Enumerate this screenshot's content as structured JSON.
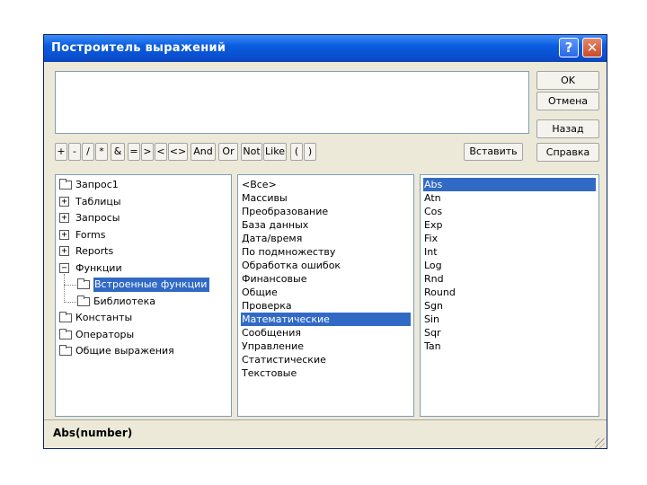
{
  "window": {
    "title": "Построитель выражений",
    "help_glyph": "?",
    "close_glyph": "✕"
  },
  "expression": {
    "value": ""
  },
  "right_buttons": {
    "ok": "OK",
    "cancel": "Отмена",
    "back": "Назад",
    "help": "Справка"
  },
  "operators": [
    "+",
    "-",
    "/",
    "*",
    "&",
    "=",
    ">",
    "<",
    "<>",
    "And",
    "Or",
    "Not",
    "Like",
    "(",
    ")"
  ],
  "insert_label": "Вставить",
  "tree": [
    {
      "label": "Запрос1",
      "expander": "",
      "level": 0
    },
    {
      "label": "Таблицы",
      "expander": "+",
      "level": 0
    },
    {
      "label": "Запросы",
      "expander": "+",
      "level": 0
    },
    {
      "label": "Forms",
      "expander": "+",
      "level": 0
    },
    {
      "label": "Reports",
      "expander": "+",
      "level": 0
    },
    {
      "label": "Функции",
      "expander": "−",
      "level": 0
    },
    {
      "label": "Встроенные функции",
      "expander": "",
      "level": 1,
      "selected": true
    },
    {
      "label": "Библиотека",
      "expander": "",
      "level": 1
    },
    {
      "label": "Константы",
      "expander": "",
      "level": 0
    },
    {
      "label": "Операторы",
      "expander": "",
      "level": 0
    },
    {
      "label": "Общие выражения",
      "expander": "",
      "level": 0
    }
  ],
  "categories": {
    "items": [
      "<Все>",
      "Массивы",
      "Преобразование",
      "База данных",
      "Дата/время",
      "По подмножеству",
      "Обработка ошибок",
      "Финансовые",
      "Общие",
      "Проверка",
      "Математические",
      "Сообщения",
      "Управление",
      "Статистические",
      "Текстовые"
    ],
    "selected_index": 10
  },
  "functions": {
    "items": [
      "Abs",
      "Atn",
      "Cos",
      "Exp",
      "Fix",
      "Int",
      "Log",
      "Rnd",
      "Round",
      "Sgn",
      "Sin",
      "Sqr",
      "Tan"
    ],
    "selected_index": 0
  },
  "status": {
    "syntax": "Abs(number)"
  },
  "colors": {
    "selection": "#316ac5",
    "titlebar": "#0a5ce0",
    "face": "#ece9d8"
  }
}
